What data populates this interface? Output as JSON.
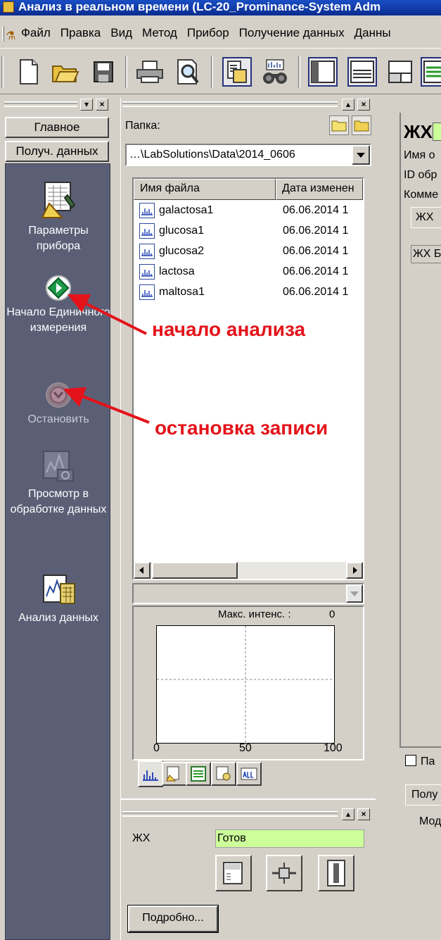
{
  "window": {
    "title": "Анализ в реальном времени (LC-20_Prominance-System Adm"
  },
  "menu": {
    "items": [
      "Файл",
      "Правка",
      "Вид",
      "Метод",
      "Прибор",
      "Получение данных",
      "Данны"
    ]
  },
  "toolbar": {
    "buttons": [
      "new-file-icon",
      "open-folder-icon",
      "save-icon",
      "print-icon",
      "preview-icon",
      "data-report-icon",
      "binoculars-icon",
      "layout-1-icon",
      "layout-2-icon",
      "layout-3-icon",
      "layout-4-icon"
    ]
  },
  "nav": {
    "tabs": {
      "main": "Главное",
      "acquisition": "Получ. данных"
    },
    "items": {
      "instrument_params": "Параметры прибора",
      "start_single": "Начало Единичного измерения",
      "stop": "Остановить",
      "view_in_processing": "Просмотр в обработке данных",
      "data_analysis": "Анализ данных"
    }
  },
  "folder": {
    "label": "Папка:",
    "path": "…\\LabSolutions\\Data\\2014_0606",
    "columns": [
      "Имя файла",
      "Дата изменен"
    ],
    "files": [
      {
        "name": "galactosa1",
        "date": "06.06.2014 1"
      },
      {
        "name": "glucosa1",
        "date": "06.06.2014 1"
      },
      {
        "name": "glucosa2",
        "date": "06.06.2014 1"
      },
      {
        "name": "lactosa",
        "date": "06.06.2014 1"
      },
      {
        "name": "maltosa1",
        "date": "06.06.2014 1"
      }
    ]
  },
  "preview": {
    "max_label": "Макс. интенс. :",
    "max_value": "0",
    "x_ticks": [
      "0",
      "50",
      "100"
    ]
  },
  "status": {
    "lc_label": "ЖХ",
    "state": "Готов",
    "detail_button": "Подробно..."
  },
  "right": {
    "title": "ЖХ",
    "lines": [
      "Имя о",
      "ID обр",
      "Комме"
    ],
    "subtab": "ЖХ",
    "box": "ЖХ Б",
    "lower_caption": "Па",
    "lower_tab": "Полу",
    "lower_mode": "Мод"
  },
  "annotations": {
    "start": "начало анализа",
    "stop": "остановка записи"
  },
  "colors": {
    "nav_bg": "#5a5f76",
    "title_bg": "#0a2c8f",
    "status_ready": "#ccff99",
    "annotation": "#e4131a"
  }
}
